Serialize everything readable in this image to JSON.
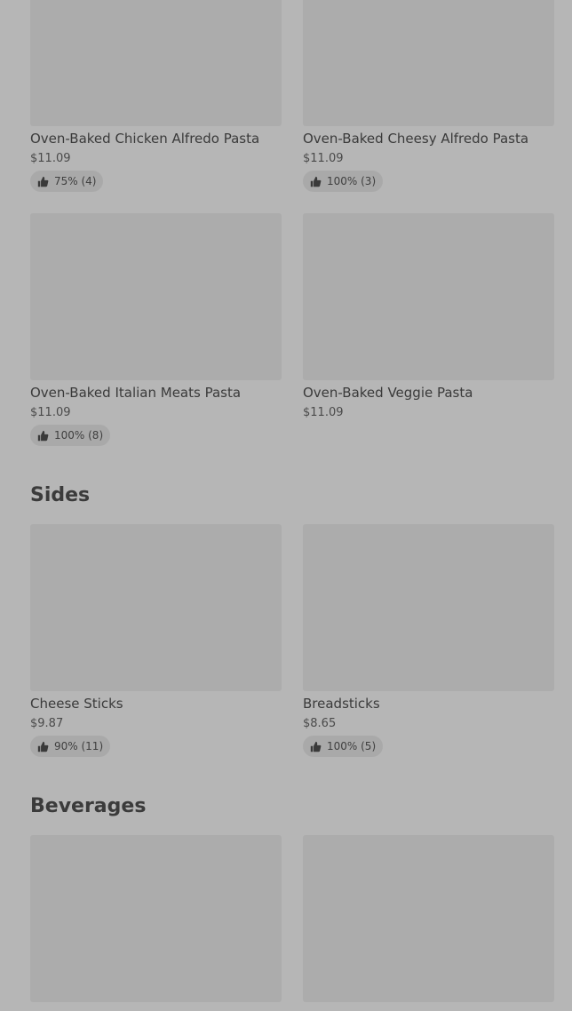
{
  "sections": {
    "sides_title": "Sides",
    "beverages_title": "Beverages"
  },
  "items": [
    {
      "name": "Oven-Baked Chicken Alfredo Pasta",
      "price": "$11.09",
      "rating": "75% (4)"
    },
    {
      "name": "Oven-Baked Cheesy Alfredo Pasta",
      "price": "$11.09",
      "rating": "100% (3)"
    },
    {
      "name": "Oven-Baked Italian Meats Pasta",
      "price": "$11.09",
      "rating": "100% (8)"
    },
    {
      "name": "Oven-Baked Veggie Pasta",
      "price": "$11.09"
    },
    {
      "name": "Cheese Sticks",
      "price": "$9.87",
      "rating": "90% (11)"
    },
    {
      "name": "Breadsticks",
      "price": "$8.65",
      "rating": "100% (5)"
    }
  ],
  "icons": {
    "rating": "thumbs-up-icon"
  },
  "colors": {
    "background": "#b6b6b6",
    "image_placeholder": "#acacac",
    "rating_pill": "#a9a9a9"
  }
}
